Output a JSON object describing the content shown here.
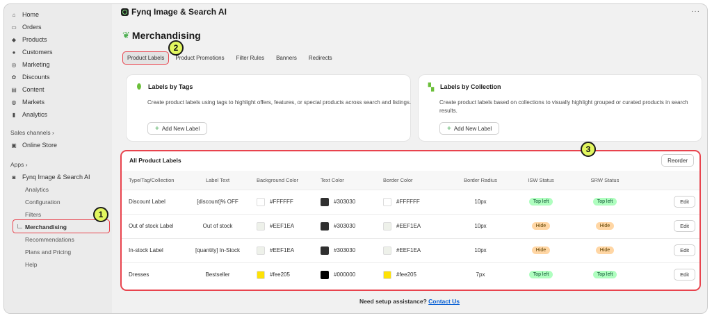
{
  "sidebar": {
    "items": [
      {
        "label": "Home",
        "icon": "home-icon",
        "glyph": "⌂"
      },
      {
        "label": "Orders",
        "icon": "orders-icon",
        "glyph": "▭"
      },
      {
        "label": "Products",
        "icon": "products-icon",
        "glyph": "◆"
      },
      {
        "label": "Customers",
        "icon": "customers-icon",
        "glyph": "●"
      },
      {
        "label": "Marketing",
        "icon": "marketing-icon",
        "glyph": "◎"
      },
      {
        "label": "Discounts",
        "icon": "discounts-icon",
        "glyph": "✿"
      },
      {
        "label": "Content",
        "icon": "content-icon",
        "glyph": "▤"
      },
      {
        "label": "Markets",
        "icon": "markets-icon",
        "glyph": "◍"
      },
      {
        "label": "Analytics",
        "icon": "analytics-icon",
        "glyph": "▮"
      }
    ],
    "sales_channels_label": "Sales channels ›",
    "online_store_label": "Online Store",
    "apps_label": "Apps ›",
    "app_name": "Fynq Image & Search AI",
    "app_sub_items": [
      "Analytics",
      "Configuration",
      "Filters",
      "Merchandising",
      "Recommendations",
      "Plans and Pricing",
      "Help"
    ]
  },
  "badges": {
    "one": "1",
    "two": "2",
    "three": "3"
  },
  "header": {
    "app_title": "Fynq Image & Search AI",
    "more": "···"
  },
  "page": {
    "title": "Merchandising"
  },
  "tabs": [
    "Product Labels",
    "Product Promotions",
    "Filter Rules",
    "Banners",
    "Redirects"
  ],
  "cards": {
    "tags": {
      "title": "Labels by Tags",
      "description": "Create product labels using tags to highlight offers, features, or special products across search and listings.",
      "button": "Add New Label"
    },
    "collection": {
      "title": "Labels by Collection",
      "description": "Create product labels based on collections to visually highlight grouped or curated products in search results.",
      "button": "Add New Label"
    }
  },
  "table": {
    "title": "All Product Labels",
    "reorder": "Reorder",
    "columns": [
      "Type/Tag/Collection",
      "Label Text",
      "Background Color",
      "Text Color",
      "Border Color",
      "Border Radius",
      "ISW Status",
      "SRW Status"
    ],
    "rows": [
      {
        "type": "Discount Label",
        "text": "[discount]% OFF",
        "bg": "#FFFFFF",
        "tc": "#303030",
        "bc": "#FFFFFF",
        "radius": "10px",
        "isw": "Top left",
        "srw": "Top left",
        "edit": "Edit"
      },
      {
        "type": "Out of stock Label",
        "text": "Out of stock",
        "bg": "#EEF1EA",
        "tc": "#303030",
        "bc": "#EEF1EA",
        "radius": "10px",
        "isw": "Hide",
        "srw": "Hide",
        "edit": "Edit"
      },
      {
        "type": "In-stock Label",
        "text": "[quantity] In-Stock",
        "bg": "#EEF1EA",
        "tc": "#303030",
        "bc": "#EEF1EA",
        "radius": "10px",
        "isw": "Hide",
        "srw": "Hide",
        "edit": "Edit"
      },
      {
        "type": "Dresses",
        "text": "Bestseller",
        "bg": "#fee205",
        "tc": "#000000",
        "bc": "#fee205",
        "radius": "7px",
        "isw": "Top left",
        "srw": "Top left",
        "edit": "Edit"
      }
    ]
  },
  "footer": {
    "text": "Need setup assistance?",
    "link": "Contact Us"
  },
  "colors": {
    "highlight": "#e8434d",
    "badge": "#e2f65f",
    "link": "#005bd3",
    "pill_green": "#affebf",
    "pill_orange": "#ffd6a4"
  }
}
